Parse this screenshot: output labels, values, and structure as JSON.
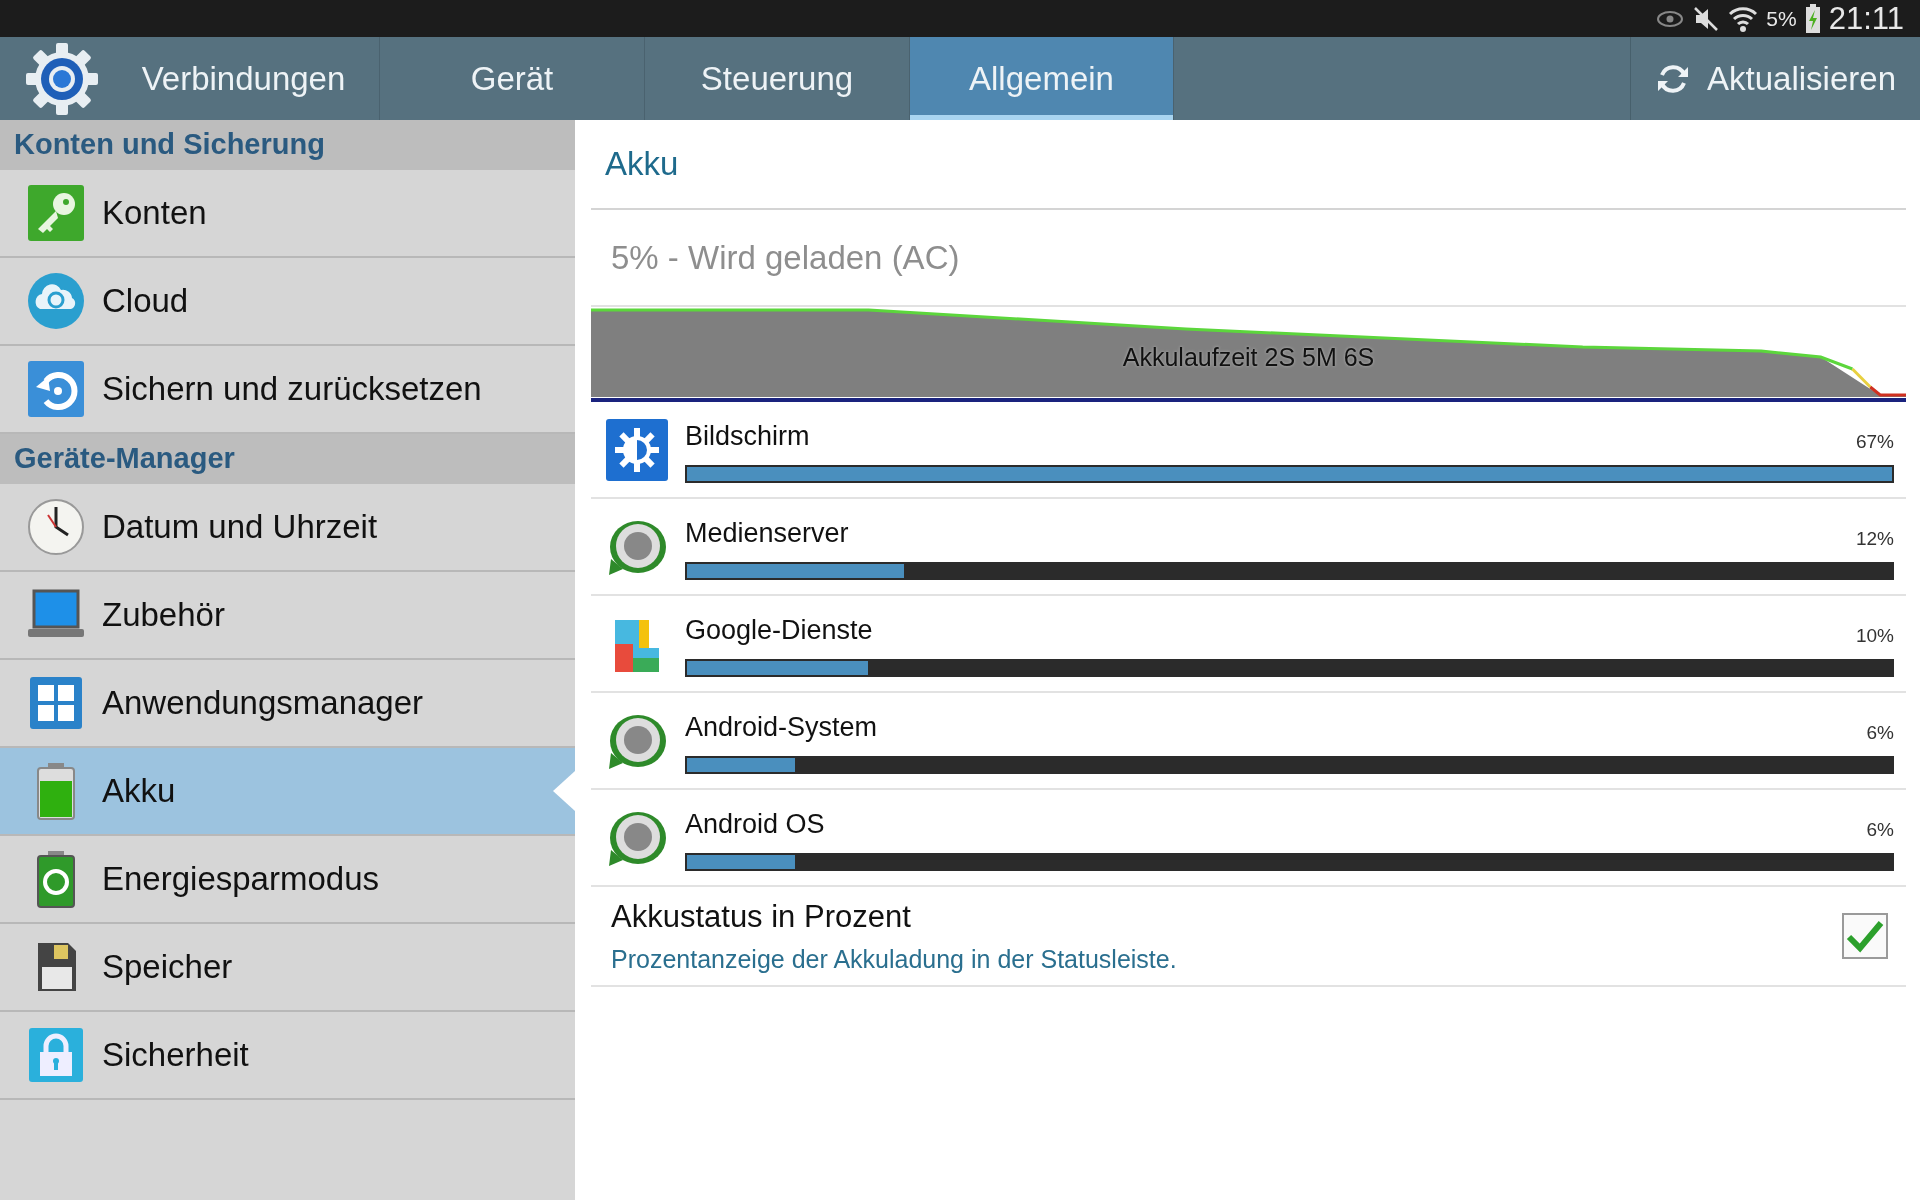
{
  "status_bar": {
    "battery_text": "5%",
    "time": "21:11"
  },
  "tabs": [
    {
      "label": "Verbindungen",
      "selected": false
    },
    {
      "label": "Gerät",
      "selected": false
    },
    {
      "label": "Steuerung",
      "selected": false
    },
    {
      "label": "Allgemein",
      "selected": true
    }
  ],
  "refresh_button": {
    "label": "Aktualisieren"
  },
  "sidebar": {
    "sections": [
      {
        "title": "Konten und Sicherung",
        "items": [
          {
            "label": "Konten",
            "selected": false
          },
          {
            "label": "Cloud",
            "selected": false
          },
          {
            "label": "Sichern und zurücksetzen",
            "selected": false
          }
        ]
      },
      {
        "title": "Geräte-Manager",
        "items": [
          {
            "label": "Datum und Uhrzeit",
            "selected": false
          },
          {
            "label": "Zubehör",
            "selected": false
          },
          {
            "label": "Anwendungsmanager",
            "selected": false
          },
          {
            "label": "Akku",
            "selected": true
          },
          {
            "label": "Energiesparmodus",
            "selected": false
          },
          {
            "label": "Speicher",
            "selected": false
          },
          {
            "label": "Sicherheit",
            "selected": false
          }
        ]
      }
    ]
  },
  "detail": {
    "title": "Akku",
    "status": "5% - Wird geladen (AC)",
    "graph_label": "Akkulaufzeit 2S 5M 6S",
    "apps": [
      {
        "name": "Bildschirm",
        "percent": "67%",
        "level": 1.0
      },
      {
        "name": "Medienserver",
        "percent": "12%",
        "level": 0.18
      },
      {
        "name": "Google-Dienste",
        "percent": "10%",
        "level": 0.15
      },
      {
        "name": "Android-System",
        "percent": "6%",
        "level": 0.09
      },
      {
        "name": "Android OS",
        "percent": "6%",
        "level": 0.09
      }
    ],
    "setting": {
      "title": "Akkustatus in Prozent",
      "description": "Prozentanzeige der Akkuladung in der Statusleiste.",
      "checked": true
    }
  }
}
